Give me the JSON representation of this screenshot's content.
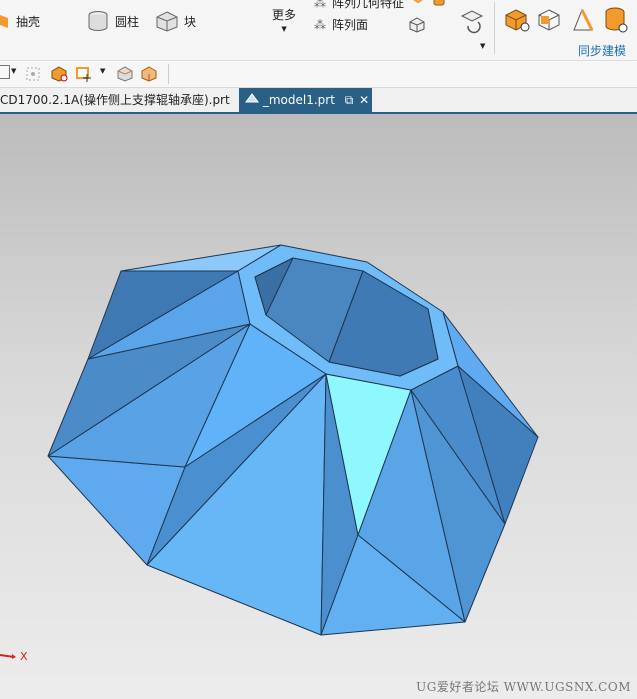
{
  "ribbon": {
    "shell": "抽壳",
    "cylinder": "圆柱",
    "block": "块",
    "more": "更多",
    "pattern_geometry": "阵列几何特征",
    "pattern_face": "阵列面",
    "sync_modeling": "同步建模"
  },
  "tabs": [
    {
      "label": "CD1700.2.1A(操作侧上支撑辊轴承座).prt"
    },
    {
      "label": "_model1.prt"
    }
  ],
  "viewport": {
    "axis_label": "X",
    "watermark": "UG爱好者论坛 WWW.UGSNX.COM"
  },
  "colors": {
    "accent": "#2a5f86",
    "model_blue": "#5aa8f0",
    "model_highlight": "#8ff8ff"
  }
}
